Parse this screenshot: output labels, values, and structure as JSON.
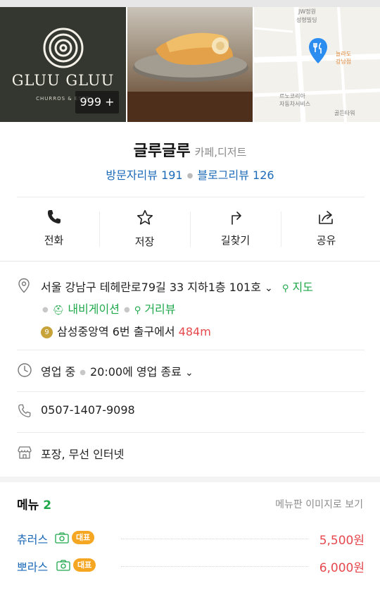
{
  "photos": {
    "logo_text": "GLUU GLUU",
    "logo_subtext": "CHURROS & ESPR",
    "photo_count": "999 +",
    "map_labels": [
      "JW정원",
      "성형빌딩",
      "늘라도",
      "강남점",
      "르노코리아",
      "자동차서비스",
      "골든타워"
    ]
  },
  "place": {
    "name": "글루글루",
    "category": "카페,디저트",
    "visitor_reviews": "방문자리뷰 191",
    "blog_reviews": "블로그리뷰 126"
  },
  "actions": [
    {
      "label": "전화",
      "icon": "phone-icon"
    },
    {
      "label": "저장",
      "icon": "star-icon"
    },
    {
      "label": "길찾기",
      "icon": "directions-icon"
    },
    {
      "label": "공유",
      "icon": "share-icon"
    }
  ],
  "info": {
    "address": "서울 강남구 테헤란로79길 33 지하1층 101호",
    "map_link": "지도",
    "navigation_link": "내비게이션",
    "street_view_link": "거리뷰",
    "subway_line": "9",
    "subway_station": "삼성중앙역",
    "subway_exit": "6번 출구에서",
    "subway_distance": "484m",
    "hours_status": "영업 중",
    "hours_detail": "20:00에 영업 종료",
    "phone": "0507-1407-9098",
    "amenities": "포장, 무선 인터넷"
  },
  "menu": {
    "title": "메뉴",
    "count": "2",
    "image_link": "메뉴판 이미지로 보기",
    "badge_label": "대표",
    "items": [
      {
        "name": "츄러스",
        "price": "5,500원"
      },
      {
        "name": "뽀라스",
        "price": "6,000원"
      }
    ]
  },
  "colors": {
    "link_blue": "#1c6ab8",
    "green": "#1ea84a",
    "price_red": "#e5484d",
    "badge_orange": "#f5a623",
    "map_pin_blue": "#2c8df0"
  }
}
